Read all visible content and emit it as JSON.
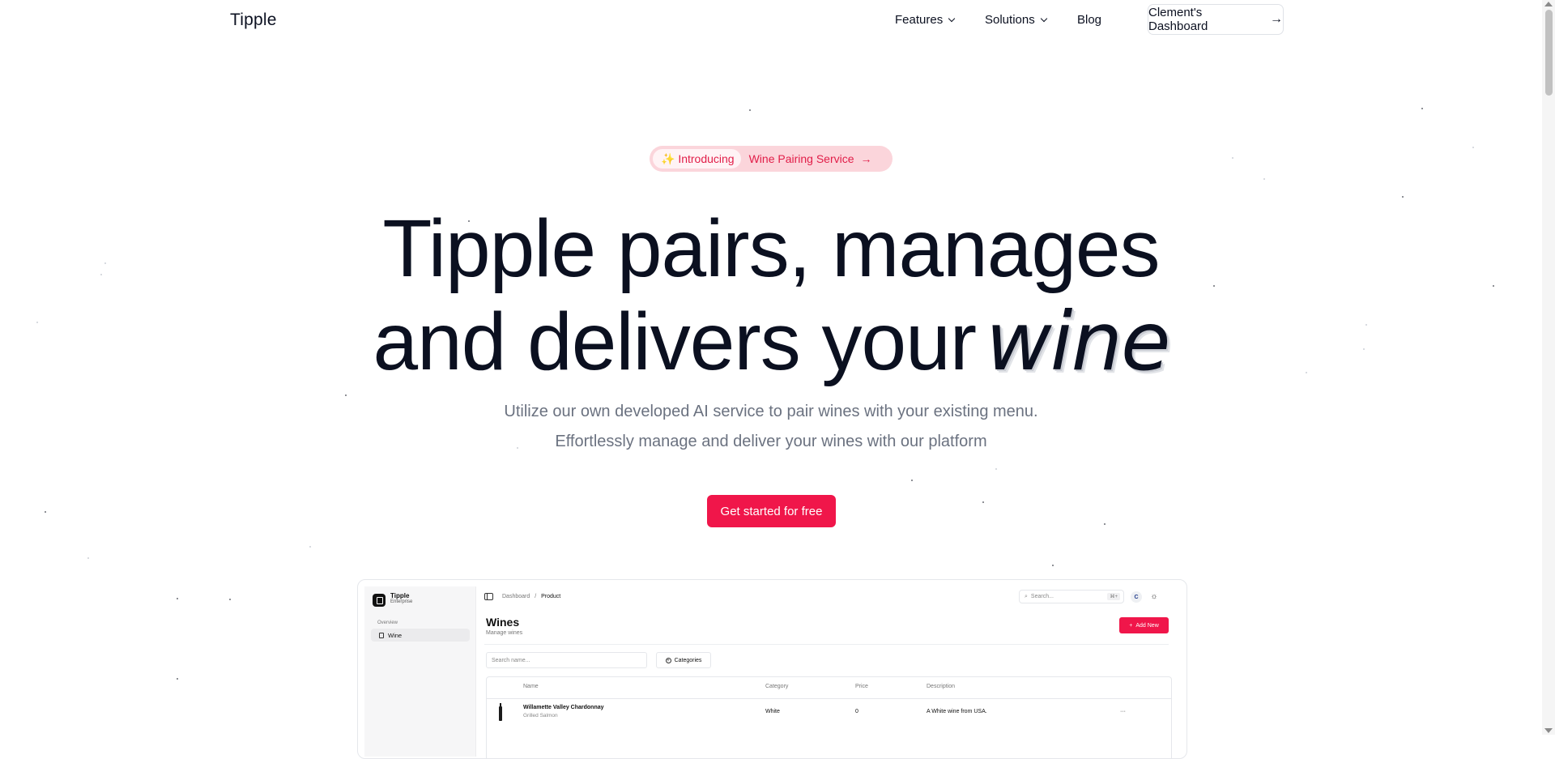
{
  "nav": {
    "logo": "Tipple",
    "features": "Features",
    "solutions": "Solutions",
    "blog": "Blog",
    "dashboard": "Clement's Dashboard"
  },
  "badge": {
    "intro": "✨ Introducing",
    "text": "Wine Pairing Service"
  },
  "hero": {
    "line1": "Tipple pairs, manages",
    "line2": "and delivers your",
    "accent": "wine",
    "sub1": "Utilize our own developed AI service to pair wines with your existing menu.",
    "sub2": "Effortlessly manage and deliver your wines with our platform",
    "cta": "Get started for free"
  },
  "preview": {
    "brand": "Tipple",
    "brand_sub": "Enterprise",
    "overview": "Overview",
    "nav_wine": "Wine",
    "crumb_1": "Dashboard",
    "crumb_sep": "/",
    "crumb_2": "Product",
    "search": "Search...",
    "kbd": "⌘+",
    "avatar": "C",
    "title": "Wines",
    "subtitle": "Manage wines",
    "add_new": "Add New",
    "search_name": "Search name...",
    "categories": "Categories",
    "columns": [
      "Name",
      "Category",
      "Price",
      "Description"
    ],
    "rows": [
      {
        "name": "Willamette Valley Chardonnay",
        "pairing": "Grilled Salmon",
        "category": "White",
        "price": "0",
        "description": "A White wine from USA.",
        "actions": "···"
      }
    ]
  },
  "colors": {
    "brand": "#f0164a",
    "badge_bg": "#fbd5db",
    "text": "#0b1020",
    "muted": "#6b7280"
  }
}
